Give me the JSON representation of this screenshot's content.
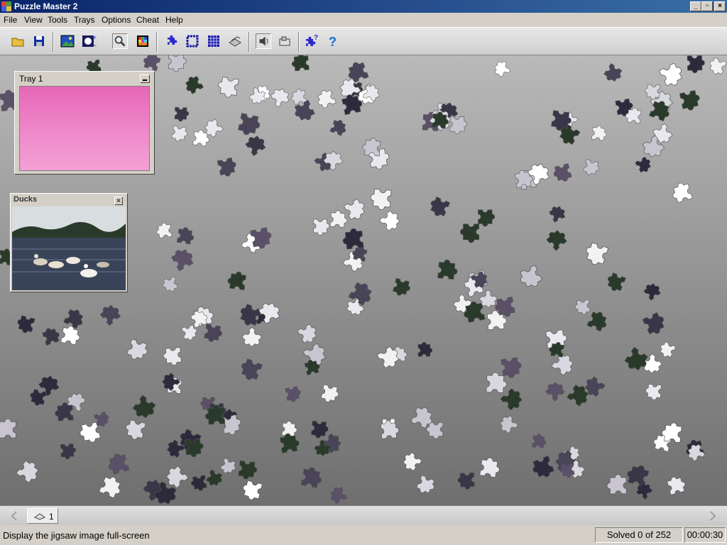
{
  "window": {
    "title": "Puzzle Master 2"
  },
  "menu": [
    "File",
    "View",
    "Tools",
    "Trays",
    "Options",
    "Cheat",
    "Help"
  ],
  "toolbar": {
    "icons": [
      "open-folder-icon",
      "save-icon",
      "picture-icon",
      "ghost-image-icon",
      "zoom-icon",
      "full-screen-icon",
      "colors-icon",
      "scatter-icon",
      "border-icon",
      "grid-icon",
      "tray-icon",
      "sound-icon",
      "sort-icon",
      "help-pieces-icon",
      "help-icon"
    ]
  },
  "tray": {
    "title": "Tray 1",
    "color": "#e667b6"
  },
  "preview": {
    "title": "Ducks",
    "close_glyph": "×"
  },
  "bottom": {
    "tray_tab_label": "1"
  },
  "status": {
    "message": "Display the jigsaw image full-screen",
    "solved": "Solved 0 of 252",
    "timer": "00:00:30"
  }
}
